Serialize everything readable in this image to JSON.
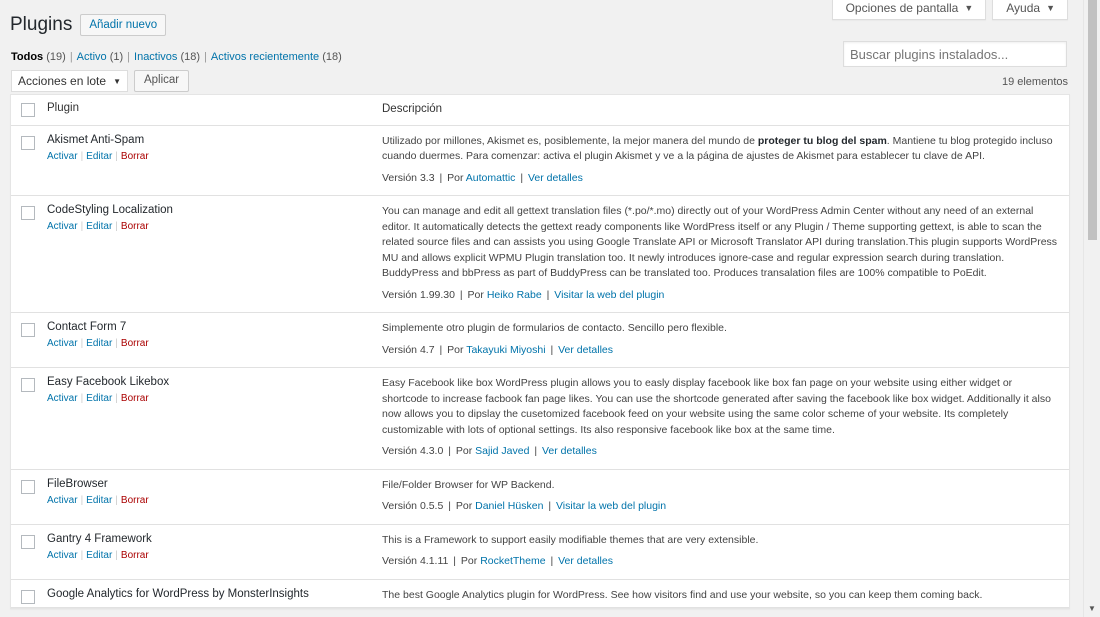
{
  "screen_meta": {
    "screen_options": "Opciones de pantalla",
    "help": "Ayuda"
  },
  "header": {
    "title": "Plugins",
    "add_new": "Añadir nuevo"
  },
  "filters": [
    {
      "label": "Todos",
      "count": "(19)",
      "current": true
    },
    {
      "label": "Activo",
      "count": "(1)",
      "current": false
    },
    {
      "label": "Inactivos",
      "count": "(18)",
      "current": false
    },
    {
      "label": "Activos recientemente",
      "count": "(18)",
      "current": false
    }
  ],
  "search": {
    "placeholder": "Buscar plugins instalados..."
  },
  "bulk": {
    "selected": "Acciones en lote",
    "apply": "Aplicar"
  },
  "item_count": "19 elementos",
  "table": {
    "col_plugin": "Plugin",
    "col_desc": "Descripción",
    "actions": {
      "activate": "Activar",
      "edit": "Editar",
      "delete": "Borrar"
    },
    "rows": [
      {
        "name": "Akismet Anti-Spam",
        "desc_before": "Utilizado por millones, Akismet es, posiblemente, la mejor manera del mundo de ",
        "desc_strong": "proteger tu blog del spam",
        "desc_after": ". Mantiene tu blog protegido incluso cuando duermes. Para comenzar: activa el plugin Akismet y ve a la página de ajustes de Akismet para establecer tu clave de API.",
        "version": "Versión 3.3",
        "by": "Por",
        "author": "Automattic",
        "link": "Ver detalles",
        "has_actions": true
      },
      {
        "name": "CodeStyling Localization",
        "desc_before": "You can manage and edit all gettext translation files (*.po/*.mo) directly out of your WordPress Admin Center without any need of an external editor. It automatically detects the gettext ready components like WordPress itself or any Plugin / Theme supporting gettext, is able to scan the related source files and can assists you using Google Translate API or Microsoft Translator API during translation.This plugin supports WordPress MU and allows explicit WPMU Plugin translation too. It newly introduces ignore-case and regular expression search during translation. BuddyPress and bbPress as part of BuddyPress can be translated too. Produces transalation files are 100% compatible to PoEdit.",
        "desc_strong": "",
        "desc_after": "",
        "version": "Versión 1.99.30",
        "by": "Por",
        "author": "Heiko Rabe",
        "link": "Visitar la web del plugin",
        "has_actions": true
      },
      {
        "name": "Contact Form 7",
        "desc_before": "Simplemente otro plugin de formularios de contacto. Sencillo pero flexible.",
        "desc_strong": "",
        "desc_after": "",
        "version": "Versión 4.7",
        "by": "Por",
        "author": "Takayuki Miyoshi",
        "link": "Ver detalles",
        "has_actions": true
      },
      {
        "name": "Easy Facebook Likebox",
        "desc_before": "Easy Facebook like box WordPress plugin allows you to easly display facebook like box fan page on your website using either widget or shortcode to increase facbook fan page likes. You can use the shortcode generated after saving the facebook like box widget. Additionally it also now allows you to dipslay the cusetomized facebook feed on your website using the same color scheme of your website. Its completely customizable with lots of optional settings. Its also responsive facebook like box at the same time.",
        "desc_strong": "",
        "desc_after": "",
        "version": "Versión 4.3.0",
        "by": "Por",
        "author": "Sajid Javed",
        "link": "Ver detalles",
        "has_actions": true
      },
      {
        "name": "FileBrowser",
        "desc_before": "File/Folder Browser for WP Backend.",
        "desc_strong": "",
        "desc_after": "",
        "version": "Versión 0.5.5",
        "by": "Por",
        "author": "Daniel Hüsken",
        "link": "Visitar la web del plugin",
        "has_actions": true
      },
      {
        "name": "Gantry 4 Framework",
        "desc_before": "This is a Framework to support easily modifiable themes that are very extensible.",
        "desc_strong": "",
        "desc_after": "",
        "version": "Versión 4.1.11",
        "by": "Por",
        "author": "RocketTheme",
        "link": "Ver detalles",
        "has_actions": true
      },
      {
        "name": "Google Analytics for WordPress by MonsterInsights",
        "desc_before": "The best Google Analytics plugin for WordPress. See how visitors find and use your website, so you can keep them coming back.",
        "desc_strong": "",
        "desc_after": "",
        "version": "",
        "by": "",
        "author": "",
        "link": "",
        "has_actions": false
      }
    ]
  }
}
